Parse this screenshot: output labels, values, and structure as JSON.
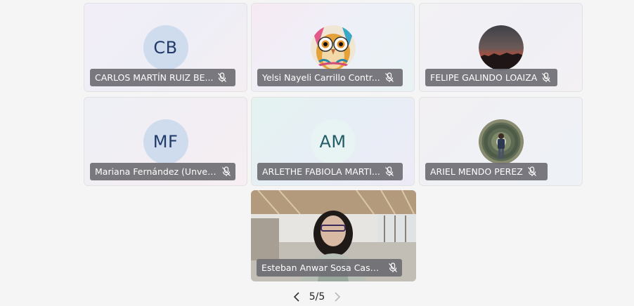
{
  "participants": [
    {
      "initials": "CB",
      "name": "CARLOS MARTÍN RUIZ BE...",
      "muted": true,
      "avatar": "initials"
    },
    {
      "initials": "",
      "name": "Yelsi Nayeli Carrillo Contr...",
      "muted": true,
      "avatar": "owl-photo"
    },
    {
      "initials": "",
      "name": "FELIPE GALINDO LOAIZA",
      "muted": true,
      "avatar": "sunset-photo"
    },
    {
      "initials": "MF",
      "name": "Mariana Fernández (Unver...",
      "muted": true,
      "avatar": "initials"
    },
    {
      "initials": "AM",
      "name": "ARLETHE FABIOLA MARTI...",
      "muted": true,
      "avatar": "initials"
    },
    {
      "initials": "",
      "name": "ARIEL MENDO PEREZ",
      "muted": true,
      "avatar": "person-tunnel-photo"
    },
    {
      "initials": "",
      "name": "Esteban Anwar Sosa Casas...",
      "muted": true,
      "avatar": "video-feed"
    }
  ],
  "pager": {
    "text": "5/5",
    "prev_icon": "chevron-left-icon",
    "next_icon": "chevron-right-icon"
  },
  "colors": {
    "label_bg": "#6e6e73",
    "avatar_blue": "#cfdced",
    "avatar_teal": "#e8f4f4",
    "page_bg": "#f5f5f5"
  }
}
